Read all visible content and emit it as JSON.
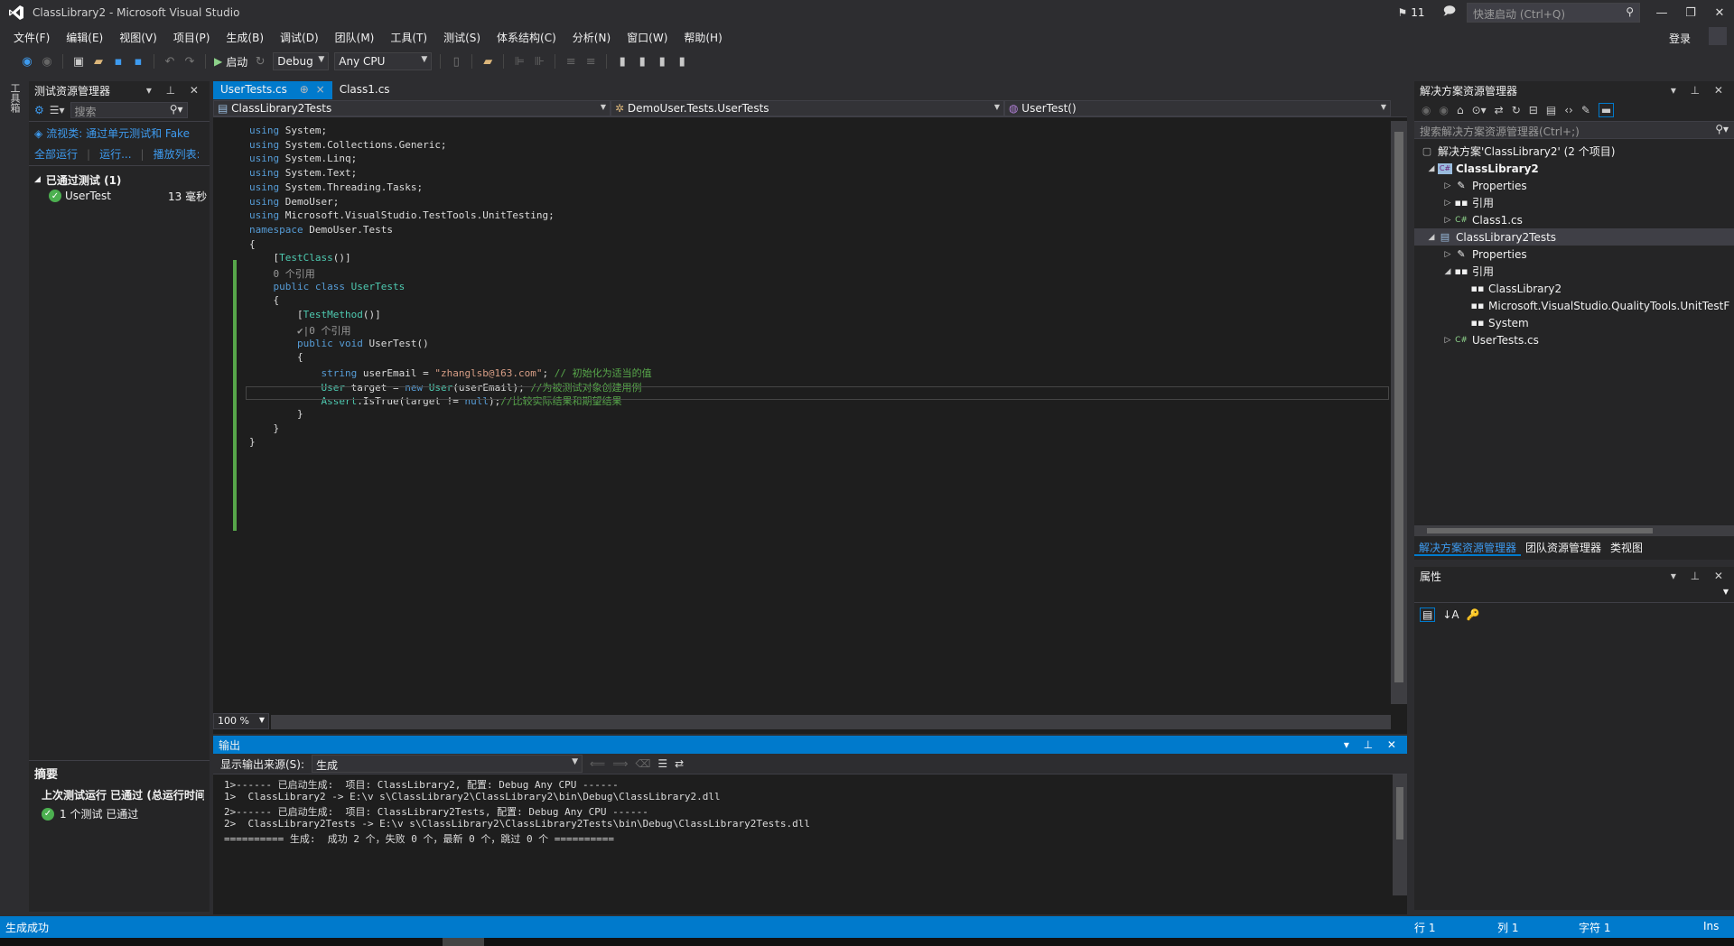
{
  "window": {
    "title": "ClassLibrary2 - Microsoft Visual Studio",
    "notifications": "11",
    "quick_launch_placeholder": "快速启动 (Ctrl+Q)",
    "login": "登录"
  },
  "menu": [
    "文件(F)",
    "编辑(E)",
    "视图(V)",
    "项目(P)",
    "生成(B)",
    "调试(D)",
    "团队(M)",
    "工具(T)",
    "测试(S)",
    "体系结构(C)",
    "分析(N)",
    "窗口(W)",
    "帮助(H)"
  ],
  "toolbar": {
    "start_label": "启动",
    "config": "Debug",
    "platform": "Any CPU"
  },
  "toolstrip": {
    "label": "工具箱"
  },
  "test_explorer": {
    "title": "测试资源管理器",
    "search_placeholder": "搜索",
    "playlist_link": "流视类: 通过单元测试和 Fake",
    "run_all": "全部运行",
    "run": "运行...",
    "playlist": "播放列表:",
    "group": "已通过测试 (1)",
    "tests": [
      {
        "name": "UserTest",
        "duration": "13 毫秒"
      }
    ],
    "summary_title": "摘要",
    "last_run": "上次测试运行 已通过 (总运行时间",
    "passed_count": "1 个测试 已通过"
  },
  "editor": {
    "tabs": [
      {
        "label": "UserTests.cs",
        "pin": "⊕",
        "close": "×"
      },
      {
        "label": "Class1.cs"
      }
    ],
    "nav": {
      "project": "ClassLibrary2Tests",
      "type": "DemoUser.Tests.UserTests",
      "member": "UserTest()"
    },
    "zoom": "100 %",
    "code": [
      [
        {
          "t": "using ",
          "c": "kw"
        },
        {
          "t": "System;"
        }
      ],
      [
        {
          "t": "using ",
          "c": "kw"
        },
        {
          "t": "System.Collections.Generic;"
        }
      ],
      [
        {
          "t": "using ",
          "c": "kw"
        },
        {
          "t": "System.Linq;"
        }
      ],
      [
        {
          "t": "using ",
          "c": "kw"
        },
        {
          "t": "System.Text;"
        }
      ],
      [
        {
          "t": "using ",
          "c": "kw"
        },
        {
          "t": "System.Threading.Tasks;"
        }
      ],
      [
        {
          "t": "using ",
          "c": "kw"
        },
        {
          "t": "DemoUser;"
        }
      ],
      [
        {
          "t": "using ",
          "c": "kw"
        },
        {
          "t": "Microsoft.VisualStudio.TestTools.UnitTesting;"
        }
      ],
      [
        {
          "t": "namespace ",
          "c": "kw"
        },
        {
          "t": "DemoUser.Tests"
        }
      ],
      [
        {
          "t": "{"
        }
      ],
      [
        {
          "t": "    ["
        },
        {
          "t": "TestClass",
          "c": "ty"
        },
        {
          "t": "()]"
        }
      ],
      [
        {
          "t": "    0 个引用",
          "c": "lens"
        }
      ],
      [
        {
          "t": "    "
        },
        {
          "t": "public class ",
          "c": "kw"
        },
        {
          "t": "UserTests",
          "c": "ty"
        }
      ],
      [
        {
          "t": "    {"
        }
      ],
      [
        {
          "t": "        ["
        },
        {
          "t": "TestMethod",
          "c": "ty"
        },
        {
          "t": "()]"
        }
      ],
      [
        {
          "t": "        ✔|0 个引用",
          "c": "lens"
        }
      ],
      [
        {
          "t": "        "
        },
        {
          "t": "public void ",
          "c": "kw"
        },
        {
          "t": "UserTest()"
        }
      ],
      [
        {
          "t": "        {"
        }
      ],
      [
        {
          "t": "            "
        },
        {
          "t": "string ",
          "c": "kw"
        },
        {
          "t": "userEmail = "
        },
        {
          "t": "\"zhanglsb@163.com\"",
          "c": "st"
        },
        {
          "t": "; "
        },
        {
          "t": "// 初始化为适当的值",
          "c": "cm"
        }
      ],
      [
        {
          "t": "            "
        },
        {
          "t": "User",
          "c": "ty"
        },
        {
          "t": " target = "
        },
        {
          "t": "new ",
          "c": "kw"
        },
        {
          "t": "User",
          "c": "ty"
        },
        {
          "t": "(userEmail); "
        },
        {
          "t": "//为被测试对象创建用例",
          "c": "cm"
        }
      ],
      [
        {
          "t": "            "
        },
        {
          "t": "Assert",
          "c": "ty"
        },
        {
          "t": ".IsTrue(target != "
        },
        {
          "t": "null",
          "c": "kw"
        },
        {
          "t": ");"
        },
        {
          "t": "//比较实际结果和期望结果",
          "c": "cm"
        }
      ],
      [
        {
          "t": "        }"
        }
      ],
      [
        {
          "t": "    }"
        }
      ],
      [
        {
          "t": "}"
        }
      ]
    ]
  },
  "output": {
    "title": "输出",
    "source_label": "显示输出来源(S):",
    "source_value": "生成",
    "lines": [
      "1>------ 已启动生成:  项目: ClassLibrary2, 配置: Debug Any CPU ------",
      "1>  ClassLibrary2 -> E:\\v s\\ClassLibrary2\\ClassLibrary2\\bin\\Debug\\ClassLibrary2.dll",
      "2>------ 已启动生成:  项目: ClassLibrary2Tests, 配置: Debug Any CPU ------",
      "2>  ClassLibrary2Tests -> E:\\v s\\ClassLibrary2\\ClassLibrary2Tests\\bin\\Debug\\ClassLibrary2Tests.dll",
      "========== 生成:  成功 2 个，失败 0 个，最新 0 个，跳过 0 个 =========="
    ]
  },
  "solution_explorer": {
    "title": "解决方案资源管理器",
    "search_placeholder": "搜索解决方案资源管理器(Ctrl+;)",
    "solution": "解决方案'ClassLibrary2' (2 个项目)",
    "project1": "ClassLibrary2",
    "properties": "Properties",
    "references": "引用",
    "class1": "Class1.cs",
    "project2": "ClassLibrary2Tests",
    "ref_items": [
      "ClassLibrary2",
      "Microsoft.VisualStudio.QualityTools.UnitTestF",
      "System"
    ],
    "usertests": "UserTests.cs",
    "tabs": [
      "解决方案资源管理器",
      "团队资源管理器",
      "类视图"
    ]
  },
  "properties": {
    "title": "属性"
  },
  "status": {
    "message": "生成成功",
    "line": "行 1",
    "col": "列 1",
    "char": "字符 1",
    "mode": "Ins"
  }
}
